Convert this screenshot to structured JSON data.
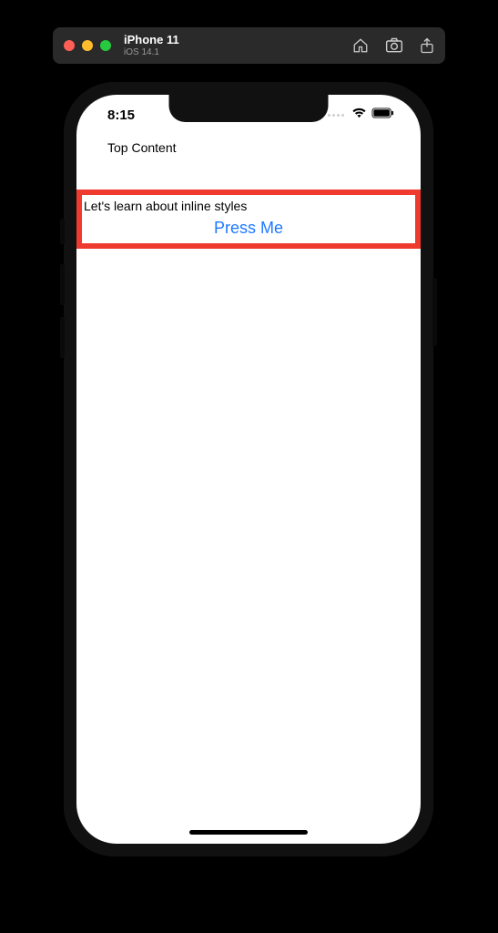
{
  "simulator": {
    "device_name": "iPhone 11",
    "os_version": "iOS 14.1"
  },
  "status_bar": {
    "time": "8:15"
  },
  "app": {
    "top_content_label": "Top Content",
    "inline_box": {
      "text": "Let's learn about inline styles",
      "button_label": "Press Me"
    }
  },
  "colors": {
    "accent_red": "#ef3a2f",
    "link_blue": "#1e7aff"
  }
}
